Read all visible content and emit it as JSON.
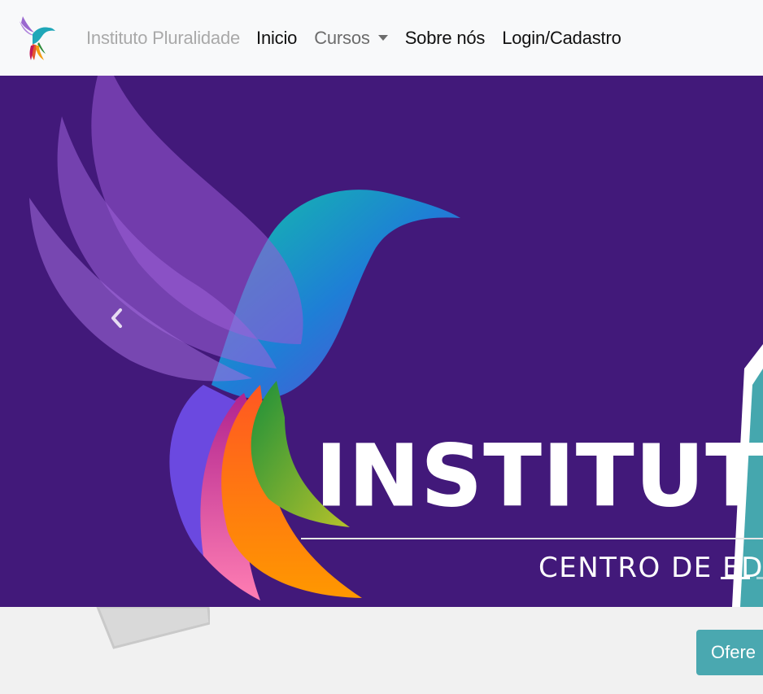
{
  "navbar": {
    "brand": "Instituto Pluralidade",
    "items": [
      {
        "label": "Inicio"
      },
      {
        "label": "Cursos"
      },
      {
        "label": "Sobre nós"
      },
      {
        "label": "Login/Cadastro"
      }
    ]
  },
  "carousel": {
    "slide_title": "INSTITUTO",
    "slide_subtitle": "CENTRO DE EDU",
    "prev_icon": "chevron-left-icon",
    "indicators": [
      {
        "active": true
      },
      {
        "active": false
      }
    ]
  },
  "main": {
    "offer_button": "Ofere"
  },
  "colors": {
    "navbar_bg": "#f8f9fa",
    "banner_bg": "#42197a",
    "teal": "#4aa8b0",
    "brand_gray": "#a9a9a9"
  }
}
